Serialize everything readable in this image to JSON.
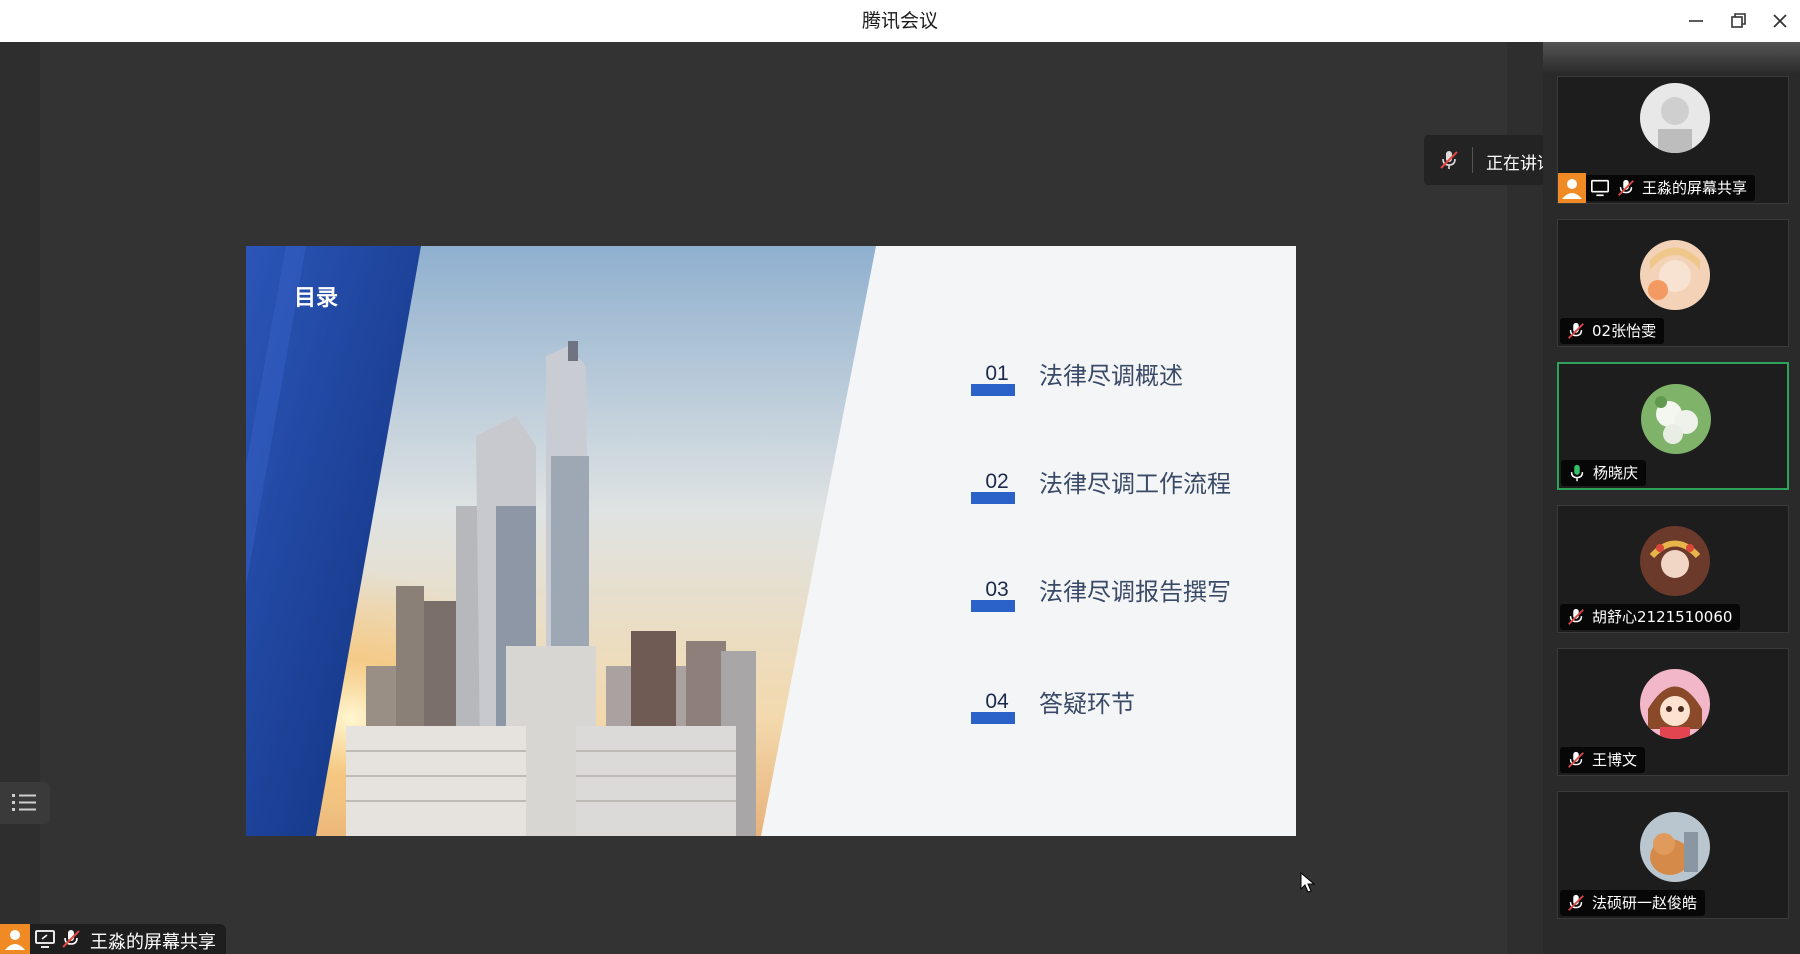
{
  "window": {
    "title": "腾讯会议"
  },
  "slide": {
    "title": "目录",
    "items": [
      {
        "num": "01",
        "label": "法律尽调概述"
      },
      {
        "num": "02",
        "label": "法律尽调工作流程"
      },
      {
        "num": "03",
        "label": "法律尽调报告撰写"
      },
      {
        "num": "04",
        "label": "答疑环节"
      }
    ]
  },
  "share_tag": {
    "label": "王淼的屏幕共享"
  },
  "speaking": {
    "text": "正在讲话: 杨晓庆;"
  },
  "participants": [
    {
      "name": "王淼的屏幕共享",
      "mic": "muted",
      "sharing": true
    },
    {
      "name": "02张怡雯",
      "mic": "muted"
    },
    {
      "name": "杨晓庆",
      "mic": "active"
    },
    {
      "name": "胡舒心2121510060",
      "mic": "muted"
    },
    {
      "name": "王博文",
      "mic": "muted"
    },
    {
      "name": "法硕研一赵俊皓",
      "mic": "muted"
    }
  ],
  "colors": {
    "active_border": "#2fa15a",
    "accent_blue": "#2a62c9",
    "share_orange": "#f08a24"
  }
}
